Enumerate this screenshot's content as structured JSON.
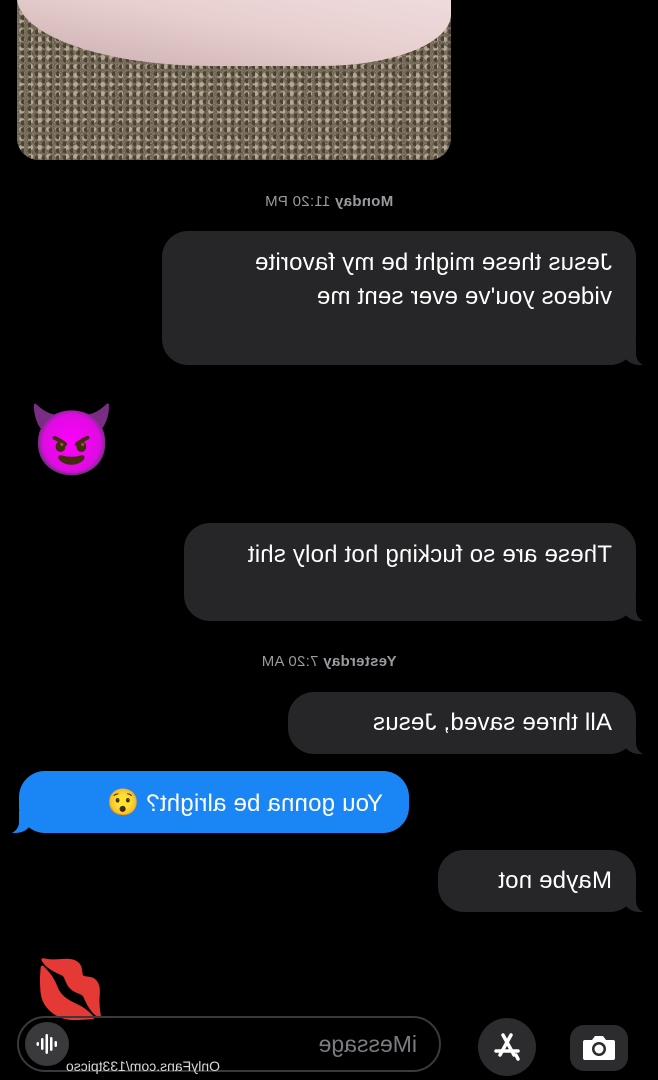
{
  "messages": {
    "timestamp_1": {
      "day": "Monday",
      "time": "11:20 PM"
    },
    "recv_1": "Jesus these might be my favorite videos you've ever sent me",
    "emoji_devil": "😈",
    "recv_2": "These are so fucking hot holy shit",
    "timestamp_2": {
      "day": "Yesterday",
      "time": "7:20 AM"
    },
    "recv_3": "All three saved, Jesus",
    "sent_1": {
      "text": "You gonna be alright?",
      "emoji": "😯"
    },
    "recv_4": "Maybe not",
    "emoji_kiss": "💋"
  },
  "composer": {
    "placeholder": "iMessage",
    "camera_icon": "camera-icon",
    "appstore_icon": "app-store-icon",
    "audio_icon": "audio-waveform-icon"
  },
  "watermark": "OnlyFans.com/133tpicso",
  "colors": {
    "received_bubble": "#262629",
    "sent_bubble": "#1a86f5",
    "background": "#000000"
  }
}
